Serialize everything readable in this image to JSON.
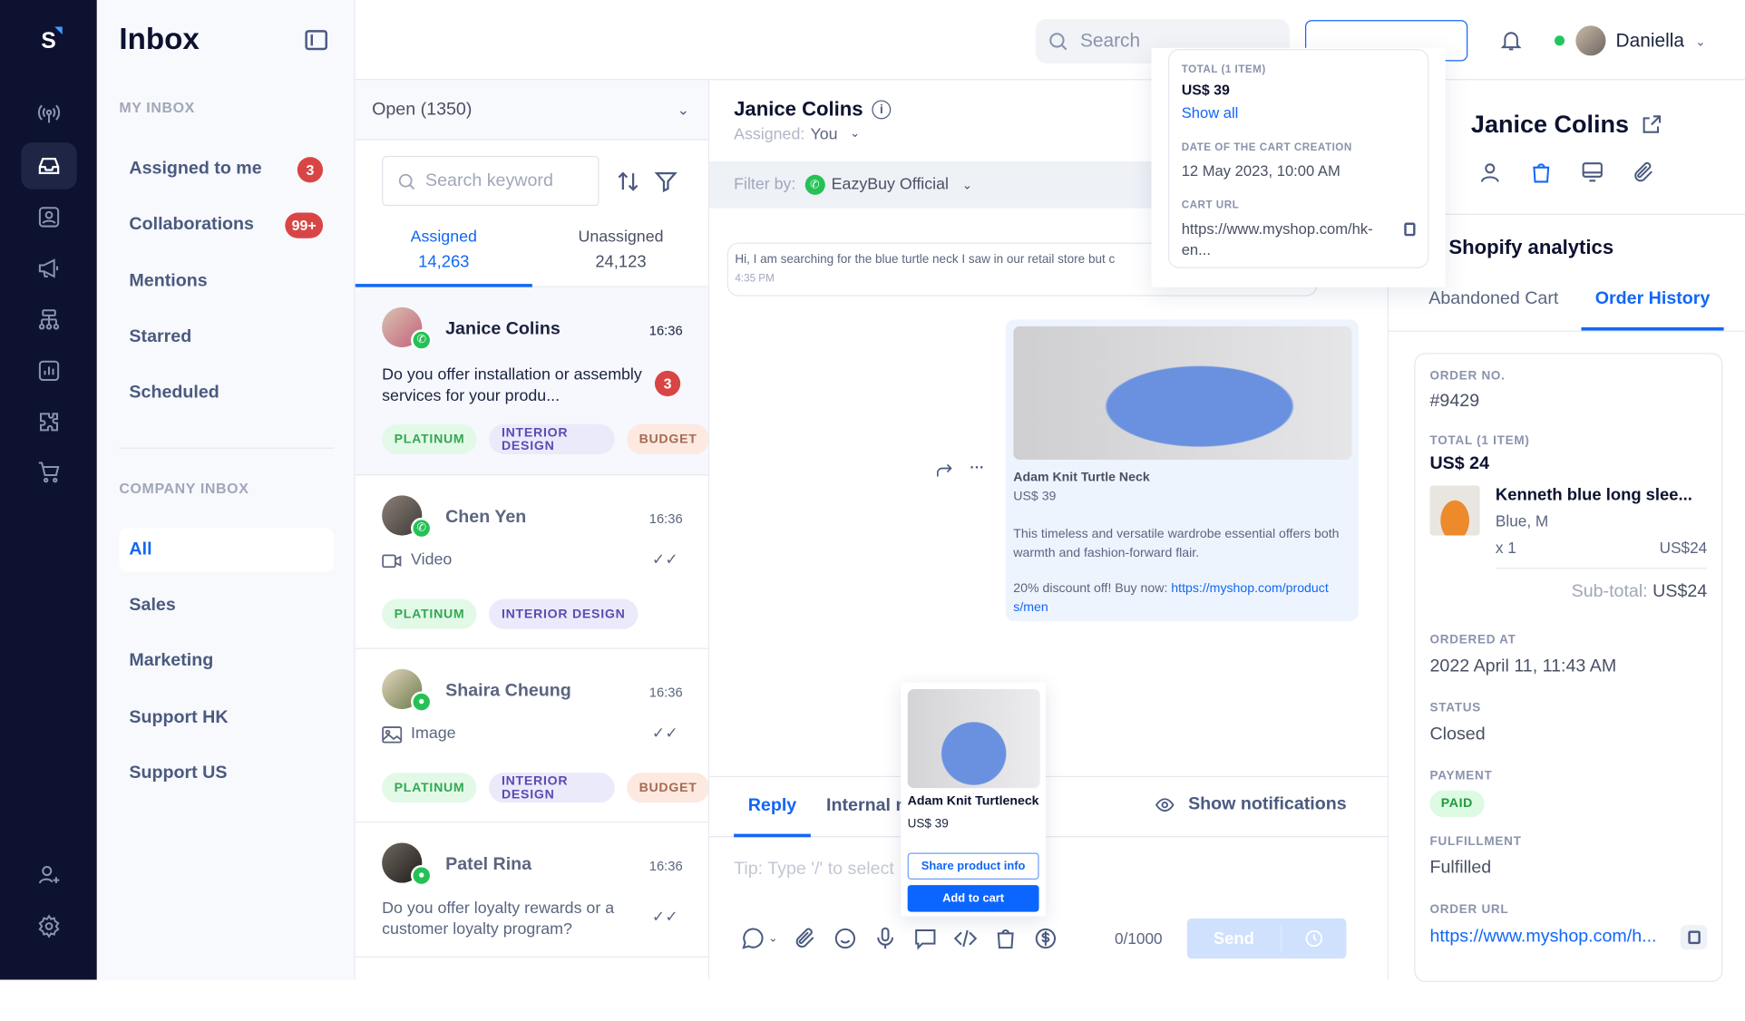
{
  "app": {
    "logo": "S",
    "title": "Inbox"
  },
  "rail": {
    "icons": [
      "broadcast-icon",
      "inbox-icon",
      "contacts-icon",
      "campaign-icon",
      "flow-icon",
      "analytics-icon",
      "integrations-icon",
      "commerce-icon",
      "invite-user-icon",
      "settings-icon"
    ],
    "active": "inbox-icon"
  },
  "nav": {
    "my_inbox_label": "MY INBOX",
    "my_items": [
      {
        "label": "Assigned to me",
        "badge": "3"
      },
      {
        "label": "Collaborations",
        "badge": "99+"
      },
      {
        "label": "Mentions"
      },
      {
        "label": "Starred"
      },
      {
        "label": "Scheduled"
      }
    ],
    "company_inbox_label": "COMPANY INBOX",
    "company_items": [
      {
        "label": "All",
        "selected": true
      },
      {
        "label": "Sales"
      },
      {
        "label": "Marketing"
      },
      {
        "label": "Support HK"
      },
      {
        "label": "Support US"
      }
    ]
  },
  "topbar": {
    "search_placeholder": "Search",
    "user_name": "Daniella",
    "status_color": "#22c55e"
  },
  "list": {
    "status_filter": "Open (1350)",
    "search_placeholder": "Search keyword",
    "tabs": [
      {
        "label": "Assigned",
        "count": "14,263",
        "active": true
      },
      {
        "label": "Unassigned",
        "count": "24,123"
      }
    ],
    "conversations": [
      {
        "name": "Janice Colins",
        "time": "16:36",
        "message": "Do you offer installation or assembly services for your produ...",
        "unread": "3",
        "channel": "whatsapp",
        "tags": [
          "PLATINUM",
          "INTERIOR DESIGN",
          "BUDGET"
        ]
      },
      {
        "name": "Chen Yen",
        "time": "16:36",
        "message": "Video",
        "media": "video",
        "channel": "whatsapp",
        "tags": [
          "PLATINUM",
          "INTERIOR DESIGN"
        ]
      },
      {
        "name": "Shaira Cheung",
        "time": "16:36",
        "message": "Image",
        "media": "image",
        "channel": "wechat",
        "tags": [
          "PLATINUM",
          "INTERIOR DESIGN",
          "BUDGET"
        ]
      },
      {
        "name": "Patel Rina",
        "time": "16:36",
        "message": "Do you offer loyalty rewards or a customer loyalty program?",
        "channel": "sms",
        "tags": []
      }
    ]
  },
  "chat": {
    "contact_name": "Janice Colins",
    "assigned_label": "Assigned:",
    "assigned_value": "You",
    "filter_label": "Filter by:",
    "filter_value": "EazyBuy Official",
    "incoming": {
      "text": "Hi, I am searching for the blue turtle neck I saw in our retail store but c",
      "time": "4:35 PM"
    },
    "product_message": {
      "name": "Adam Knit Turtle Neck",
      "price": "US$ 39",
      "description": "This timeless and versatile wardrobe essential offers both warmth and fashion-forward flair.",
      "promo": "20% discount off! Buy now: ",
      "link": "https://myshop.com/products/men"
    },
    "product_popup": {
      "name": "Adam Knit Turtleneck",
      "price": "US$ 39",
      "share_label": "Share product info",
      "cart_label": "Add to cart"
    },
    "reply_tabs": [
      {
        "label": "Reply",
        "active": true
      },
      {
        "label": "Internal note"
      }
    ],
    "show_notifications": "Show notifications",
    "input_placeholder": "Tip: Type '/' to select",
    "char_count": "0/1000",
    "send_label": "Send"
  },
  "cart_popup": {
    "total_label": "TOTAL (1 ITEM)",
    "total_value": "US$ 39",
    "show_all": "Show all",
    "date_label": "DATE OF THE CART CREATION",
    "date_value": "12 May 2023, 10:00 AM",
    "url_label": "CART URL",
    "url_value": "https://www.myshop.com/hk-en..."
  },
  "right": {
    "contact_name": "Janice Colins",
    "section_title": "Shopify analytics",
    "tabs": [
      {
        "label": "Abandoned Cart"
      },
      {
        "label": "Order History",
        "active": true
      }
    ],
    "order": {
      "no_label": "ORDER NO.",
      "no_value": "#9429",
      "total_label": "TOTAL (1 ITEM)",
      "total_value": "US$ 24",
      "item_name": "Kenneth blue long slee...",
      "item_variant": "Blue, M",
      "item_qty": "x 1",
      "item_price": "US$24",
      "subtotal_label": "Sub-total:",
      "subtotal_value": "US$24",
      "ordered_label": "ORDERED AT",
      "ordered_value": "2022 April 11, 11:43 AM",
      "status_label": "STATUS",
      "status_value": "Closed",
      "payment_label": "PAYMENT",
      "payment_value": "PAID",
      "fulfillment_label": "FULFILLMENT",
      "fulfillment_value": "Fulfilled",
      "url_label": "ORDER URL",
      "url_value": "https://www.myshop.com/h..."
    }
  },
  "colors": {
    "accent": "#1267f5",
    "rail": "#0d1230",
    "badge": "#d94545"
  }
}
